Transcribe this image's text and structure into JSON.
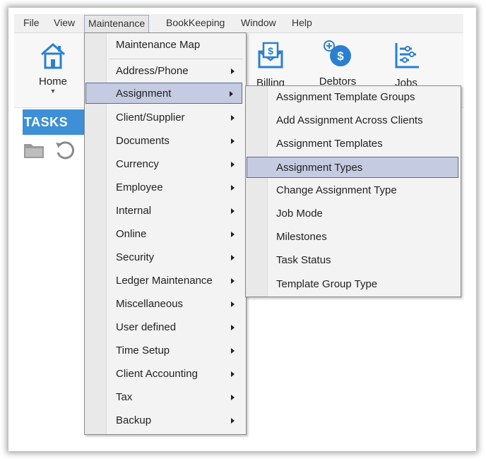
{
  "menubar": {
    "items": [
      "File",
      "View",
      "Maintenance",
      "BookKeeping",
      "Window",
      "Help"
    ]
  },
  "ribbon": {
    "home_label": "Home",
    "billing_label": "Billing",
    "debtors_label": "Debtors",
    "jobs_label": "Jobs"
  },
  "tasks": {
    "title": "TASKS"
  },
  "maintenance_menu": {
    "items": [
      {
        "label": "Maintenance Map",
        "submenu": false
      },
      {
        "label": "Address/Phone",
        "submenu": true
      },
      {
        "label": "Assignment",
        "submenu": true
      },
      {
        "label": "Client/Supplier",
        "submenu": true
      },
      {
        "label": "Documents",
        "submenu": true
      },
      {
        "label": "Currency",
        "submenu": true
      },
      {
        "label": "Employee",
        "submenu": true
      },
      {
        "label": "Internal",
        "submenu": true
      },
      {
        "label": "Online",
        "submenu": true
      },
      {
        "label": "Security",
        "submenu": true
      },
      {
        "label": "Ledger Maintenance",
        "submenu": true
      },
      {
        "label": "Miscellaneous",
        "submenu": true
      },
      {
        "label": "User defined",
        "submenu": true
      },
      {
        "label": "Time Setup",
        "submenu": true
      },
      {
        "label": "Client Accounting",
        "submenu": true
      },
      {
        "label": "Tax",
        "submenu": true
      },
      {
        "label": "Backup",
        "submenu": true
      }
    ],
    "highlighted": "Assignment"
  },
  "assignment_submenu": {
    "items": [
      "Assignment Template Groups",
      "Add Assignment Across Clients",
      "Assignment Templates",
      "Assignment Types",
      "Change Assignment Type",
      "Job Mode",
      "Milestones",
      "Task Status",
      "Template Group Type"
    ],
    "highlighted": "Assignment Types"
  },
  "colors": {
    "tasks_blue": "#3d8fd6",
    "highlight": "#c5cbe0",
    "highlight_border": "#5a6a9a",
    "icon_blue": "#2a7fd0"
  }
}
